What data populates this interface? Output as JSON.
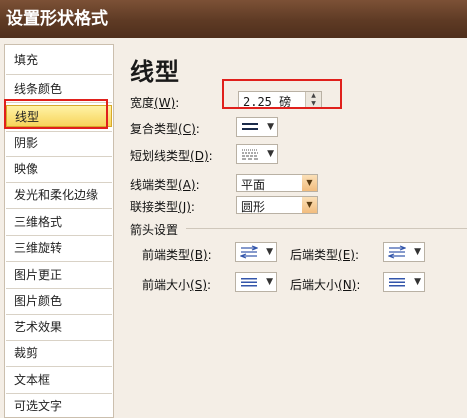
{
  "window": {
    "title": "设置形状格式"
  },
  "sidebar": {
    "items": [
      {
        "label": "填充"
      },
      {
        "label": "线条颜色"
      },
      {
        "label": "线型",
        "selected": true
      },
      {
        "label": "阴影"
      },
      {
        "label": "映像"
      },
      {
        "label": "发光和柔化边缘"
      },
      {
        "label": "三维格式"
      },
      {
        "label": "三维旋转"
      },
      {
        "label": "图片更正"
      },
      {
        "label": "图片颜色"
      },
      {
        "label": "艺术效果"
      },
      {
        "label": "裁剪"
      },
      {
        "label": "文本框"
      },
      {
        "label": "可选文字"
      }
    ]
  },
  "main": {
    "heading": "线型",
    "width": {
      "label": "宽度",
      "key": "(W)",
      "colon": ":",
      "value": "2.25 磅"
    },
    "compound_type": {
      "label": "复合类型",
      "key": "(C)",
      "colon": ":"
    },
    "dash_type": {
      "label": "短划线类型",
      "key": "(D)",
      "colon": ":"
    },
    "cap_type": {
      "label": "线端类型",
      "key": "(A)",
      "colon": ":",
      "value": "平面"
    },
    "join_type": {
      "label": "联接类型",
      "key": "(J)",
      "colon": ":",
      "value": "圆形"
    },
    "arrow_section": {
      "title": "箭头设置",
      "begin_type": {
        "label": "前端类型",
        "key": "(B)",
        "colon": ":"
      },
      "end_type": {
        "label": "后端类型",
        "key": "(E)",
        "colon": ":"
      },
      "begin_size": {
        "label": "前端大小",
        "key": "(S)",
        "colon": ":"
      },
      "end_size": {
        "label": "后端大小",
        "key": "(N)",
        "colon": ":"
      }
    }
  },
  "colors": {
    "title_bar": "#5e3a24",
    "selection": "#f7d45b",
    "highlight_outline": "#e0201c"
  },
  "icons": {
    "compound": "triple-line-icon",
    "dash": "dotted-lines-icon",
    "arrow_type": "arrow-lines-icon",
    "arrow_size": "line-size-icon",
    "dropdown": "caret-down-icon"
  }
}
